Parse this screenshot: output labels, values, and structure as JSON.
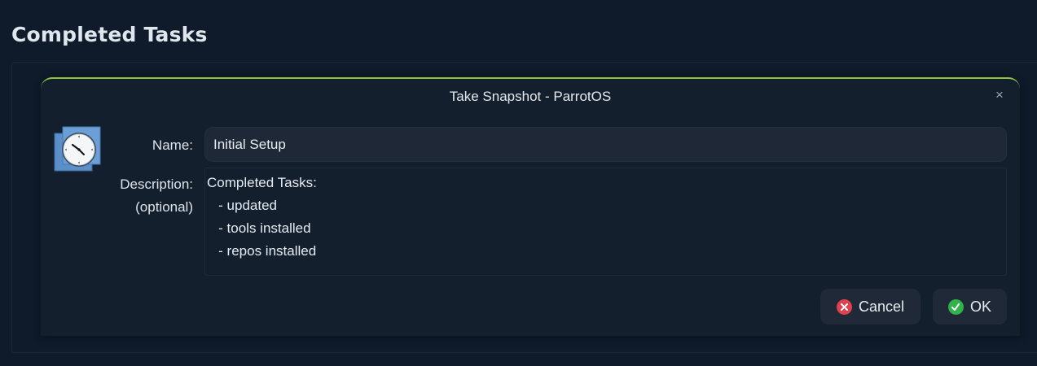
{
  "page": {
    "heading": "Completed Tasks"
  },
  "dialog": {
    "title": "Take Snapshot - ParrotOS",
    "close_glyph": "×",
    "icon": "snapshot-clock-icon",
    "name_label": "Name:",
    "name_value": "Initial Setup",
    "description_label": "Description:\n(optional)",
    "description_value": "Completed Tasks:\n   - updated\n   - tools installed\n   - repos installed",
    "buttons": {
      "cancel_label": "Cancel",
      "ok_label": "OK"
    }
  },
  "colors": {
    "background": "#0f1a2a",
    "dialog_background": "#141f2d",
    "dialog_accent": "#8fc43d",
    "cancel_icon": "#e0414f",
    "ok_icon": "#2fb34a"
  }
}
